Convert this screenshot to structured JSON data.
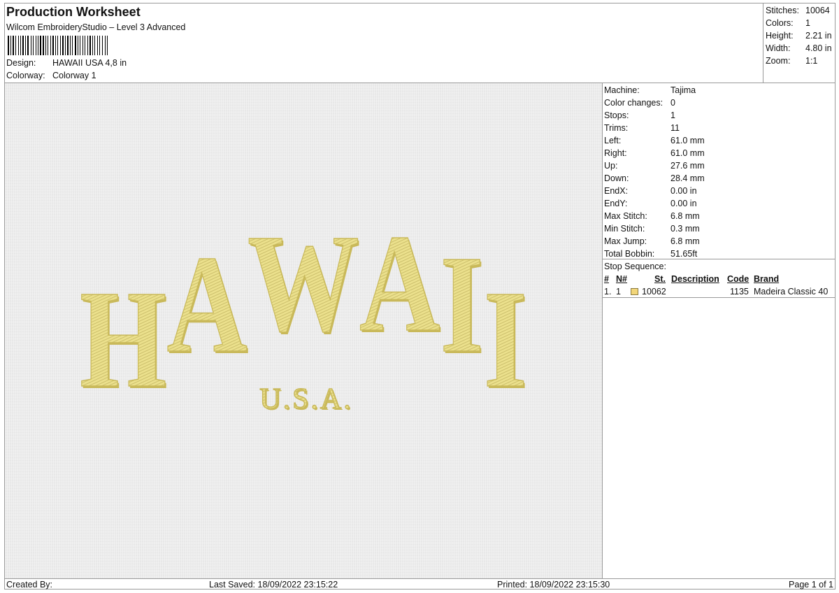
{
  "header": {
    "title": "Production Worksheet",
    "subtitle": "Wilcom EmbroideryStudio – Level 3 Advanced",
    "design_label": "Design:",
    "design_value": "HAWAII USA 4,8 in",
    "colorway_label": "Colorway:",
    "colorway_value": "Colorway 1"
  },
  "stats": [
    {
      "label": "Stitches:",
      "value": "10064"
    },
    {
      "label": "Colors:",
      "value": "1"
    },
    {
      "label": "Height:",
      "value": "2.21 in"
    },
    {
      "label": "Width:",
      "value": "4.80 in"
    },
    {
      "label": "Zoom:",
      "value": "1:1"
    }
  ],
  "details": [
    {
      "label": "Machine:",
      "value": "Tajima"
    },
    {
      "label": "Color changes:",
      "value": "0"
    },
    {
      "label": "Stops:",
      "value": "1"
    },
    {
      "label": "Trims:",
      "value": "11"
    },
    {
      "label": "Left:",
      "value": "61.0 mm"
    },
    {
      "label": "Right:",
      "value": "61.0 mm"
    },
    {
      "label": "Up:",
      "value": "27.6 mm"
    },
    {
      "label": "Down:",
      "value": "28.4 mm"
    },
    {
      "label": "EndX:",
      "value": "0.00 in"
    },
    {
      "label": "EndY:",
      "value": "0.00 in"
    },
    {
      "label": "Max Stitch:",
      "value": "6.8 mm"
    },
    {
      "label": "Min Stitch:",
      "value": "0.3 mm"
    },
    {
      "label": "Max Jump:",
      "value": "6.8 mm"
    },
    {
      "label": "Total Bobbin:",
      "value": "51.65ft"
    }
  ],
  "stop_sequence": {
    "heading": "Stop Sequence:",
    "columns": {
      "num": "#",
      "n": "N#",
      "st": "St.",
      "description": "Description",
      "code": "Code",
      "brand": "Brand"
    },
    "rows": [
      {
        "num": "1.",
        "n": "1",
        "st": "10062",
        "description": "",
        "code": "1135",
        "brand": "Madeira Classic 40",
        "color": "#f2d67a"
      }
    ]
  },
  "preview": {
    "main_text": "HAWAII",
    "sub_text": "U.S.A.",
    "thread_color": "#ebe08c",
    "thread_shadow": "#c9b95a"
  },
  "footer": {
    "created_by": "Created By:",
    "last_saved": "Last Saved: 18/09/2022 23:15:22",
    "printed": "Printed: 18/09/2022 23:15:30",
    "page": "Page 1 of 1"
  }
}
